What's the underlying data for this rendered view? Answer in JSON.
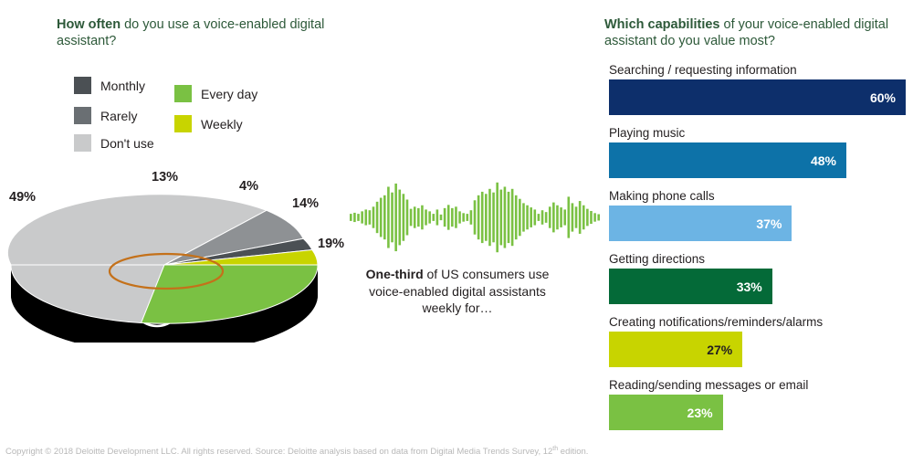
{
  "left_panel": {
    "title_bold": "How often",
    "title_rest": " do you use a voice-enabled digital assistant?",
    "legend": [
      {
        "label": "Monthly",
        "color": "#4b5054"
      },
      {
        "label": "Rarely",
        "color": "#6a6f73"
      },
      {
        "label": "Don't use",
        "color": "#c9cacb"
      },
      {
        "label": "Every day",
        "color": "#7ac143"
      },
      {
        "label": "Weekly",
        "color": "#c8d400"
      }
    ]
  },
  "center_panel": {
    "caption_bold": "One-third",
    "caption_rest": " of US consumers use voice-enabled digital assistants weekly for…",
    "waveform_color": "#7ac143"
  },
  "right_panel": {
    "title_bold": "Which capabilities",
    "title_rest": " of your voice-enabled digital assistant do you value most?"
  },
  "footer": {
    "text_before": "Copyright © 2018 Deloitte Development LLC. All rights reserved.  Source: Deloitte analysis based on data from Digital Media Trends Survey, 12",
    "superscript": "th",
    "text_after": " edition."
  },
  "chart_data": [
    {
      "type": "pie",
      "title": "How often do you use a voice-enabled digital assistant?",
      "unit": "percent",
      "labels": [
        "Don't use",
        "Rarely",
        "Monthly",
        "Weekly",
        "Every day"
      ],
      "values": [
        49,
        13,
        4,
        14,
        19
      ],
      "value_labels": [
        "49%",
        "13%",
        "4%",
        "14%",
        "19%"
      ],
      "colors": [
        "#c9cacb",
        "#8e9194",
        "#4b5054",
        "#c8d400",
        "#7ac143"
      ],
      "legend_position": "top-left",
      "style": "3d-cylinder"
    },
    {
      "type": "bar",
      "orientation": "horizontal",
      "title": "Which capabilities of your voice-enabled digital assistant do you value most?",
      "unit": "percent",
      "xlim": [
        0,
        60
      ],
      "grid": false,
      "categories": [
        "Searching / requesting information",
        "Playing music",
        "Making phone calls",
        "Getting directions",
        "Creating notifications/reminders/alarms",
        "Reading/sending messages or email"
      ],
      "values": [
        60,
        48,
        37,
        33,
        27,
        23
      ],
      "value_labels": [
        "60%",
        "48%",
        "37%",
        "33%",
        "27%",
        "23%"
      ],
      "colors": [
        "#0d2f6b",
        "#0d72a8",
        "#6cb4e4",
        "#046a38",
        "#c8d400",
        "#7ac143"
      ],
      "value_text_colors": [
        "#ffffff",
        "#ffffff",
        "#ffffff",
        "#ffffff",
        "#231f20",
        "#ffffff"
      ]
    }
  ]
}
